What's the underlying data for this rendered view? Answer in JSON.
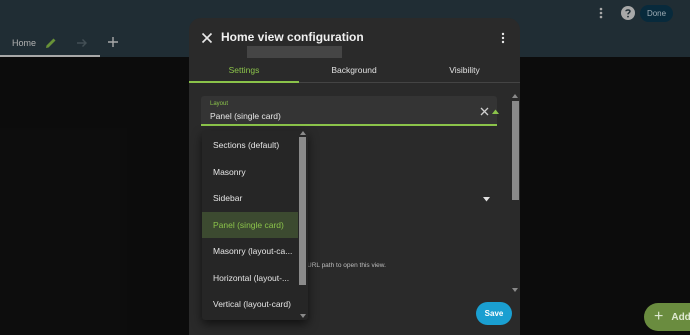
{
  "app": {
    "tab_home": "Home",
    "done_label": "Done",
    "add_label": "Add"
  },
  "dialog": {
    "title": "Home view configuration",
    "tabs": [
      "Settings",
      "Background",
      "Visibility"
    ],
    "active_tab": "Settings",
    "layout_field": {
      "label": "Layout",
      "value": "Panel (single card)"
    },
    "url_help_text": "URL path to open this view.",
    "save_label": "Save"
  },
  "layout_menu": {
    "options": [
      "Sections (default)",
      "Masonry",
      "Sidebar",
      "Panel (single card)",
      "Masonry (layout-ca...",
      "Horizontal (layout-...",
      "Vertical (layout-card)"
    ],
    "selected": "Panel (single card)"
  },
  "colors": {
    "accent_green": "#8bc34a",
    "primary_blue": "#1a9fd1",
    "header_bg": "#2b3d46",
    "dialog_bg": "#2a2a2a"
  },
  "icons": [
    "close-icon",
    "more-vert-icon",
    "pencil-icon",
    "arrow-right-icon",
    "plus-icon",
    "help-icon",
    "clear-icon",
    "caret-up-icon",
    "caret-down-icon"
  ]
}
